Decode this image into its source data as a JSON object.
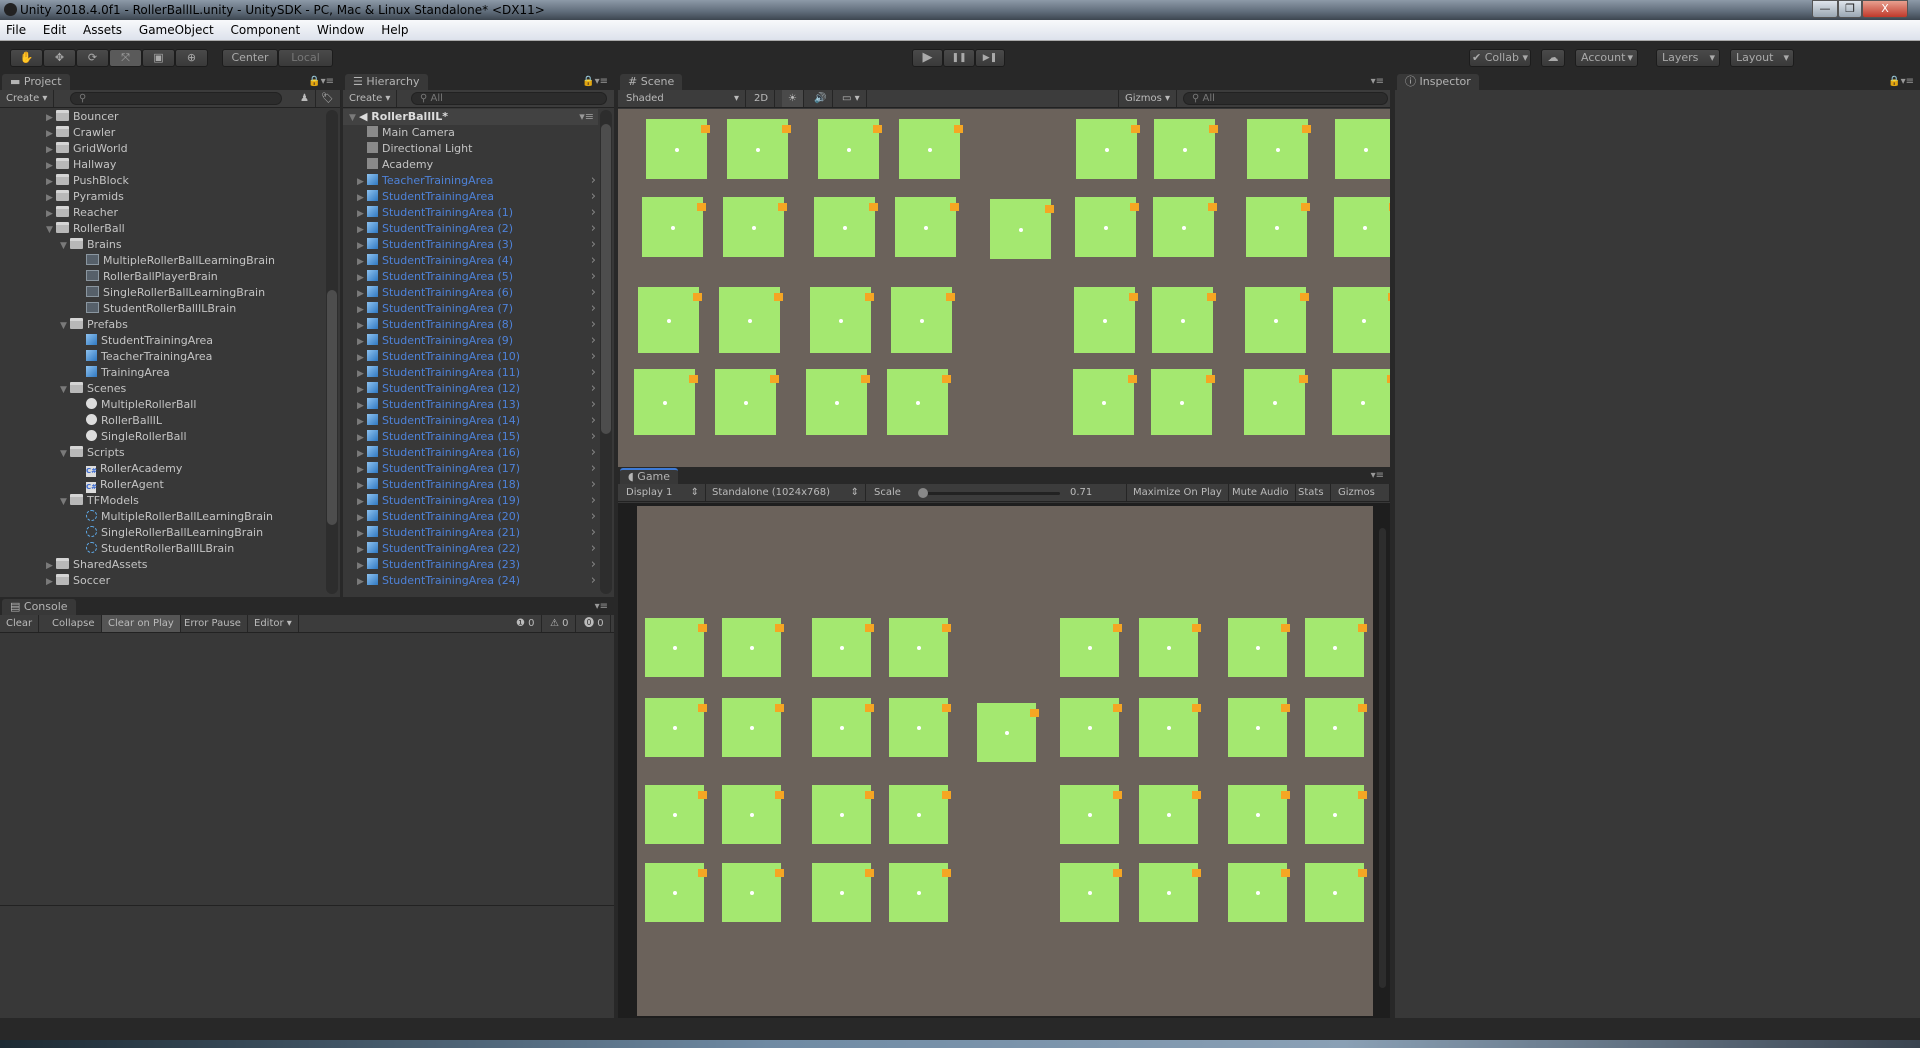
{
  "window": {
    "title": "Unity 2018.4.0f1 - RollerBallIL.unity - UnitySDK - PC, Mac & Linux Standalone* <DX11>",
    "minimize": "—",
    "restore": "❐",
    "close": "X"
  },
  "menu": [
    "File",
    "Edit",
    "Assets",
    "GameObject",
    "Component",
    "Window",
    "Help"
  ],
  "toolbar": {
    "tools": [
      "hand-tool",
      "move-tool",
      "rotate-tool",
      "scale-tool",
      "rect-tool",
      "transform-tool"
    ],
    "tool_glyphs": [
      "✋",
      "✥",
      "⟳",
      "⤧",
      "▣",
      "⊕"
    ],
    "pivot": "Center",
    "space": "Local",
    "play": "▶",
    "pause": "❚❚",
    "step": "▶❚",
    "collab": "Collab",
    "account": "Account",
    "layers": "Layers",
    "layout": "Layout"
  },
  "project": {
    "tab": "Project",
    "create": "Create",
    "items": [
      {
        "label": "Bouncer",
        "depth": 0,
        "type": "folder",
        "exp": "closed"
      },
      {
        "label": "Crawler",
        "depth": 0,
        "type": "folder",
        "exp": "closed"
      },
      {
        "label": "GridWorld",
        "depth": 0,
        "type": "folder",
        "exp": "closed"
      },
      {
        "label": "Hallway",
        "depth": 0,
        "type": "folder",
        "exp": "closed"
      },
      {
        "label": "PushBlock",
        "depth": 0,
        "type": "folder",
        "exp": "closed"
      },
      {
        "label": "Pyramids",
        "depth": 0,
        "type": "folder",
        "exp": "closed"
      },
      {
        "label": "Reacher",
        "depth": 0,
        "type": "folder",
        "exp": "closed"
      },
      {
        "label": "RollerBall",
        "depth": 0,
        "type": "folder",
        "exp": "open"
      },
      {
        "label": "Brains",
        "depth": 1,
        "type": "folder",
        "exp": "open"
      },
      {
        "label": "MultipleRollerBallLearningBrain",
        "depth": 2,
        "type": "brain"
      },
      {
        "label": "RollerBallPlayerBrain",
        "depth": 2,
        "type": "brain"
      },
      {
        "label": "SingleRollerBallLearningBrain",
        "depth": 2,
        "type": "brain"
      },
      {
        "label": "StudentRollerBallILBrain",
        "depth": 2,
        "type": "brain"
      },
      {
        "label": "Prefabs",
        "depth": 1,
        "type": "folder",
        "exp": "open"
      },
      {
        "label": "StudentTrainingArea",
        "depth": 2,
        "type": "prefab"
      },
      {
        "label": "TeacherTrainingArea",
        "depth": 2,
        "type": "prefab"
      },
      {
        "label": "TrainingArea",
        "depth": 2,
        "type": "prefab"
      },
      {
        "label": "Scenes",
        "depth": 1,
        "type": "folder",
        "exp": "open"
      },
      {
        "label": "MultipleRollerBall",
        "depth": 2,
        "type": "scene"
      },
      {
        "label": "RollerBallIL",
        "depth": 2,
        "type": "scene"
      },
      {
        "label": "SingleRollerBall",
        "depth": 2,
        "type": "scene"
      },
      {
        "label": "Scripts",
        "depth": 1,
        "type": "folder",
        "exp": "open"
      },
      {
        "label": "RollerAcademy",
        "depth": 2,
        "type": "cs"
      },
      {
        "label": "RollerAgent",
        "depth": 2,
        "type": "cs"
      },
      {
        "label": "TFModels",
        "depth": 1,
        "type": "folder",
        "exp": "open"
      },
      {
        "label": "MultipleRollerBallLearningBrain",
        "depth": 2,
        "type": "model"
      },
      {
        "label": "SingleRollerBallLearningBrain",
        "depth": 2,
        "type": "model"
      },
      {
        "label": "StudentRollerBallILBrain",
        "depth": 2,
        "type": "model"
      },
      {
        "label": "SharedAssets",
        "depth": 0,
        "type": "folder",
        "exp": "closed"
      },
      {
        "label": "Soccer",
        "depth": 0,
        "type": "folder",
        "exp": "closed"
      }
    ]
  },
  "hierarchy": {
    "tab": "Hierarchy",
    "create": "Create",
    "search_placeholder": "All",
    "scene": "RollerBallIL*",
    "items": [
      {
        "label": "Main Camera",
        "prefab": false
      },
      {
        "label": "Directional Light",
        "prefab": false
      },
      {
        "label": "Academy",
        "prefab": false
      },
      {
        "label": "TeacherTrainingArea",
        "prefab": true
      },
      {
        "label": "StudentTrainingArea",
        "prefab": true
      },
      {
        "label": "StudentTrainingArea (1)",
        "prefab": true
      },
      {
        "label": "StudentTrainingArea (2)",
        "prefab": true
      },
      {
        "label": "StudentTrainingArea (3)",
        "prefab": true
      },
      {
        "label": "StudentTrainingArea (4)",
        "prefab": true
      },
      {
        "label": "StudentTrainingArea (5)",
        "prefab": true
      },
      {
        "label": "StudentTrainingArea (6)",
        "prefab": true
      },
      {
        "label": "StudentTrainingArea (7)",
        "prefab": true
      },
      {
        "label": "StudentTrainingArea (8)",
        "prefab": true
      },
      {
        "label": "StudentTrainingArea (9)",
        "prefab": true
      },
      {
        "label": "StudentTrainingArea (10)",
        "prefab": true
      },
      {
        "label": "StudentTrainingArea (11)",
        "prefab": true
      },
      {
        "label": "StudentTrainingArea (12)",
        "prefab": true
      },
      {
        "label": "StudentTrainingArea (13)",
        "prefab": true
      },
      {
        "label": "StudentTrainingArea (14)",
        "prefab": true
      },
      {
        "label": "StudentTrainingArea (15)",
        "prefab": true
      },
      {
        "label": "StudentTrainingArea (16)",
        "prefab": true
      },
      {
        "label": "StudentTrainingArea (17)",
        "prefab": true
      },
      {
        "label": "StudentTrainingArea (18)",
        "prefab": true
      },
      {
        "label": "StudentTrainingArea (19)",
        "prefab": true
      },
      {
        "label": "StudentTrainingArea (20)",
        "prefab": true
      },
      {
        "label": "StudentTrainingArea (21)",
        "prefab": true
      },
      {
        "label": "StudentTrainingArea (22)",
        "prefab": true
      },
      {
        "label": "StudentTrainingArea (23)",
        "prefab": true
      },
      {
        "label": "StudentTrainingArea (24)",
        "prefab": true
      }
    ]
  },
  "scene": {
    "tab": "Scene",
    "shading": "Shaded",
    "mode_2d": "2D",
    "gizmos": "Gizmos",
    "search_placeholder": "All"
  },
  "game": {
    "tab": "Game",
    "display": "Display 1",
    "resolution": "Standalone (1024x768)",
    "scale_label": "Scale",
    "scale_value": "0.71",
    "maximize": "Maximize On Play",
    "mute": "Mute Audio",
    "stats": "Stats",
    "gizmos": "Gizmos"
  },
  "console": {
    "tab": "Console",
    "clear": "Clear",
    "collapse": "Collapse",
    "clear_on_play": "Clear on Play",
    "error_pause": "Error Pause",
    "editor": "Editor",
    "errors": "0",
    "warnings": "0",
    "logs": "0"
  },
  "inspector": {
    "tab": "Inspector"
  },
  "colors": {
    "ground": "#6b625b",
    "area": "#a4e870",
    "target": "#f5a623",
    "prefab_text": "#4e82d8"
  }
}
